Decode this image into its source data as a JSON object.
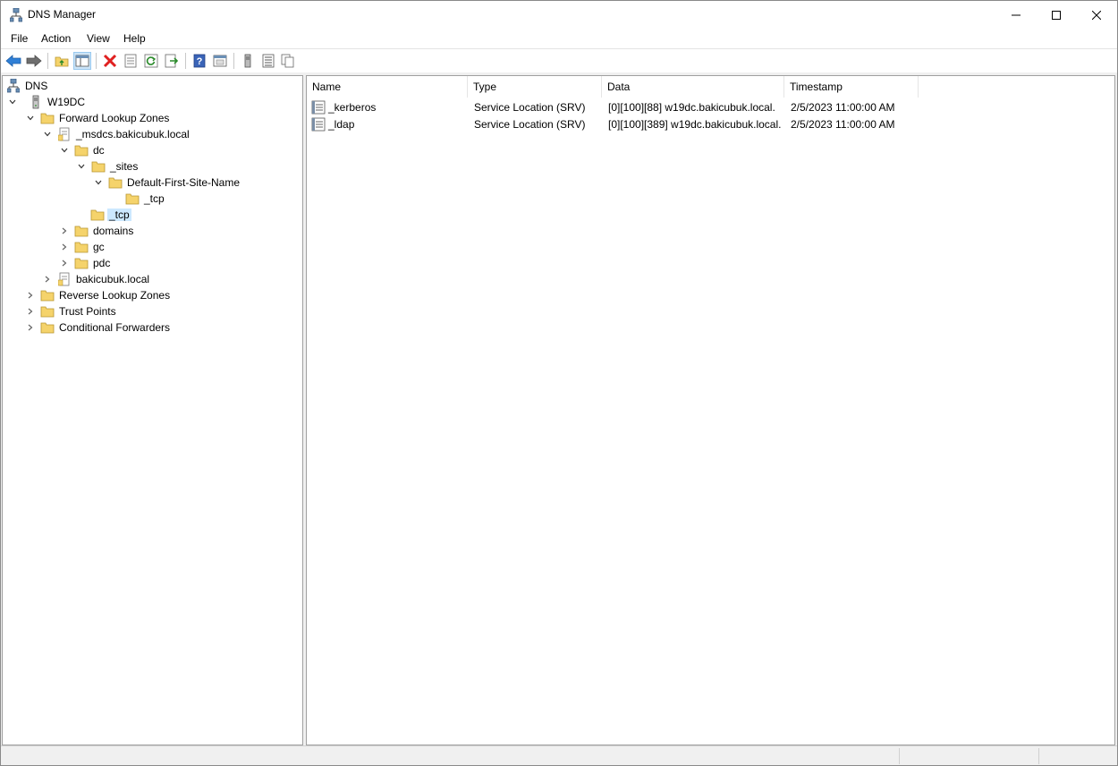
{
  "window": {
    "title": "DNS Manager"
  },
  "menu": [
    "File",
    "Action",
    "View",
    "Help"
  ],
  "toolbar": {
    "icons": [
      "back-icon",
      "forward-icon",
      "up-folder-icon",
      "show-hide-tree-icon",
      "delete-icon",
      "properties-icon",
      "refresh-icon",
      "export-icon",
      "help-icon",
      "console-icon",
      "server-icon",
      "list-icon",
      "copy-icon"
    ]
  },
  "tree": {
    "root": "DNS",
    "server": "W19DC",
    "forward_zones": "Forward Lookup Zones",
    "msdcs_zone": "_msdcs.bakicubuk.local",
    "dc": "dc",
    "sites": "_sites",
    "default_site": "Default-First-Site-Name",
    "site_tcp": "_tcp",
    "dc_tcp": "_tcp",
    "domains": "domains",
    "gc": "gc",
    "pdc": "pdc",
    "main_zone": "bakicubuk.local",
    "reverse_zones": "Reverse Lookup Zones",
    "trust_points": "Trust Points",
    "conditional_forwarders": "Conditional Forwarders"
  },
  "list": {
    "columns": [
      "Name",
      "Type",
      "Data",
      "Timestamp"
    ],
    "rows": [
      {
        "name": "_kerberos",
        "type": "Service Location (SRV)",
        "data": "[0][100][88] w19dc.bakicubuk.local.",
        "timestamp": "2/5/2023 11:00:00 AM"
      },
      {
        "name": "_ldap",
        "type": "Service Location (SRV)",
        "data": "[0][100][389] w19dc.bakicubuk.local.",
        "timestamp": "2/5/2023 11:00:00 AM"
      }
    ]
  },
  "colors": {
    "selection": "#cce8ff",
    "folder": "#f5d36b",
    "delete": "#e02020"
  }
}
